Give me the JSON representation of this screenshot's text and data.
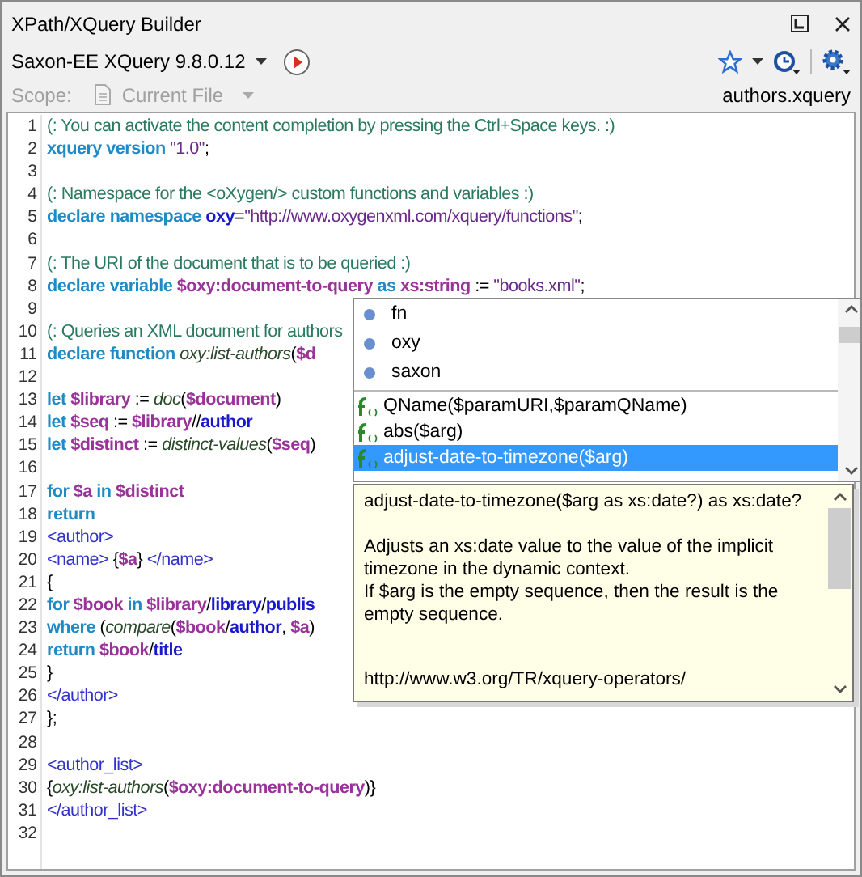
{
  "window": {
    "title": "XPath/XQuery Builder"
  },
  "toolbar": {
    "processor": "Saxon-EE XQuery 9.8.0.12"
  },
  "scope": {
    "label": "Scope:",
    "value": "Current File",
    "disabled": true,
    "file": "authors.xquery"
  },
  "editor": {
    "lines": [
      {
        "number": "1",
        "segments": [
          {
            "kind": "comment",
            "text": "(: You can activate the content completion by pressing the Ctrl+Space keys. :)"
          }
        ]
      },
      {
        "number": "2",
        "segments": [
          {
            "kind": "keyword",
            "text": "xquery version "
          },
          {
            "kind": "string",
            "text": "\"1.0\""
          },
          {
            "kind": "plain",
            "text": ";"
          }
        ]
      },
      {
        "number": "3"
      },
      {
        "number": "4",
        "segments": [
          {
            "kind": "comment",
            "text": "(: Namespace for the <oXygen/> custom functions and variables :)"
          }
        ]
      },
      {
        "number": "5",
        "segments": [
          {
            "kind": "keyword",
            "text": "declare namespace "
          },
          {
            "kind": "name",
            "text": "oxy"
          },
          {
            "kind": "plain",
            "text": "="
          },
          {
            "kind": "string",
            "text": "\"http://www.oxygenxml.com/xquery/functions\""
          },
          {
            "kind": "plain",
            "text": ";"
          }
        ]
      },
      {
        "number": "6"
      },
      {
        "number": "7",
        "segments": [
          {
            "kind": "comment",
            "text": "(: The URI of the document that is to be queried :)"
          }
        ]
      },
      {
        "number": "8",
        "segments": [
          {
            "kind": "keyword",
            "text": "declare variable "
          },
          {
            "kind": "variable",
            "text": "$oxy:document-to-query"
          },
          {
            "kind": "keyword",
            "text": " as "
          },
          {
            "kind": "variable",
            "text": "xs:string"
          },
          {
            "kind": "plain",
            "text": " := "
          },
          {
            "kind": "string",
            "text": "\"books.xml\""
          },
          {
            "kind": "plain",
            "text": ";"
          }
        ]
      },
      {
        "number": "9"
      },
      {
        "number": "10",
        "segments": [
          {
            "kind": "comment",
            "text": "(: Queries an XML document for authors"
          }
        ]
      },
      {
        "number": "11",
        "segments": [
          {
            "kind": "keyword",
            "text": "declare function "
          },
          {
            "kind": "func",
            "text": "oxy:list-authors"
          },
          {
            "kind": "plain",
            "text": "("
          },
          {
            "kind": "variable",
            "text": "$d"
          }
        ]
      },
      {
        "number": "12"
      },
      {
        "number": "13",
        "segments": [
          {
            "kind": "keyword",
            "text": "let "
          },
          {
            "kind": "variable",
            "text": "$library"
          },
          {
            "kind": "plain",
            "text": " := "
          },
          {
            "kind": "func",
            "text": "doc"
          },
          {
            "kind": "plain",
            "text": "("
          },
          {
            "kind": "variable",
            "text": "$document"
          },
          {
            "kind": "plain",
            "text": ")"
          }
        ]
      },
      {
        "number": "14",
        "segments": [
          {
            "kind": "keyword",
            "text": "let "
          },
          {
            "kind": "variable",
            "text": "$seq"
          },
          {
            "kind": "plain",
            "text": " := "
          },
          {
            "kind": "variable",
            "text": "$library"
          },
          {
            "kind": "plain",
            "text": "//"
          },
          {
            "kind": "name",
            "text": "author"
          }
        ]
      },
      {
        "number": "15",
        "segments": [
          {
            "kind": "keyword",
            "text": "let "
          },
          {
            "kind": "variable",
            "text": "$distinct"
          },
          {
            "kind": "plain",
            "text": " := "
          },
          {
            "kind": "func",
            "text": "distinct-values"
          },
          {
            "kind": "plain",
            "text": "("
          },
          {
            "kind": "variable",
            "text": "$seq"
          },
          {
            "kind": "plain",
            "text": ")"
          }
        ]
      },
      {
        "number": "16"
      },
      {
        "number": "17",
        "segments": [
          {
            "kind": "keyword",
            "text": "for "
          },
          {
            "kind": "variable",
            "text": "$a"
          },
          {
            "kind": "keyword",
            "text": " in "
          },
          {
            "kind": "variable",
            "text": "$distinct"
          }
        ]
      },
      {
        "number": "18",
        "segments": [
          {
            "kind": "keyword",
            "text": "return"
          }
        ]
      },
      {
        "number": "19",
        "segments": [
          {
            "kind": "tag",
            "text": "<author>"
          }
        ]
      },
      {
        "number": "20",
        "segments": [
          {
            "kind": "tag",
            "text": "<name> "
          },
          {
            "kind": "plain",
            "text": "{"
          },
          {
            "kind": "variable",
            "text": "$a"
          },
          {
            "kind": "plain",
            "text": "} "
          },
          {
            "kind": "tag",
            "text": "</name>"
          }
        ]
      },
      {
        "number": "21",
        "segments": [
          {
            "kind": "plain",
            "text": "{"
          }
        ]
      },
      {
        "number": "22",
        "segments": [
          {
            "kind": "keyword",
            "text": "for "
          },
          {
            "kind": "variable",
            "text": "$book"
          },
          {
            "kind": "keyword",
            "text": " in "
          },
          {
            "kind": "variable",
            "text": "$library"
          },
          {
            "kind": "plain",
            "text": "/"
          },
          {
            "kind": "name",
            "text": "library"
          },
          {
            "kind": "plain",
            "text": "/"
          },
          {
            "kind": "name",
            "text": "publis"
          }
        ]
      },
      {
        "number": "23",
        "segments": [
          {
            "kind": "keyword",
            "text": "where "
          },
          {
            "kind": "plain",
            "text": "("
          },
          {
            "kind": "func",
            "text": "compare"
          },
          {
            "kind": "plain",
            "text": "("
          },
          {
            "kind": "variable",
            "text": "$book"
          },
          {
            "kind": "plain",
            "text": "/"
          },
          {
            "kind": "name",
            "text": "author"
          },
          {
            "kind": "plain",
            "text": ", "
          },
          {
            "kind": "variable",
            "text": "$a"
          },
          {
            "kind": "plain",
            "text": ")"
          }
        ]
      },
      {
        "number": "24",
        "segments": [
          {
            "kind": "keyword",
            "text": "return "
          },
          {
            "kind": "variable",
            "text": "$book"
          },
          {
            "kind": "plain",
            "text": "/"
          },
          {
            "kind": "name",
            "text": "title"
          }
        ]
      },
      {
        "number": "25",
        "segments": [
          {
            "kind": "plain",
            "text": "}"
          }
        ]
      },
      {
        "number": "26",
        "segments": [
          {
            "kind": "tag",
            "text": "</author>"
          }
        ]
      },
      {
        "number": "27",
        "segments": [
          {
            "kind": "plain",
            "text": "};"
          }
        ]
      },
      {
        "number": "28"
      },
      {
        "number": "29",
        "segments": [
          {
            "kind": "tag",
            "text": "<author_list>"
          }
        ]
      },
      {
        "number": "30",
        "segments": [
          {
            "kind": "plain",
            "text": "{"
          },
          {
            "kind": "func",
            "text": "oxy:list-authors"
          },
          {
            "kind": "plain",
            "text": "("
          },
          {
            "kind": "variable",
            "text": "$oxy:document-to-query"
          },
          {
            "kind": "plain",
            "text": ")}"
          }
        ]
      },
      {
        "number": "31",
        "segments": [
          {
            "kind": "tag",
            "text": "</author_list>"
          }
        ]
      },
      {
        "number": "32"
      }
    ]
  },
  "completion": {
    "namespaces": [
      {
        "text": "fn",
        "selected": false
      },
      {
        "text": "oxy",
        "selected": false
      },
      {
        "text": "saxon",
        "selected": false
      }
    ],
    "functions": [
      {
        "text": "QName($paramURI,$paramQName)",
        "selected": false
      },
      {
        "text": "abs($arg)",
        "selected": false
      },
      {
        "text": "adjust-date-to-timezone($arg)",
        "selected": true
      }
    ]
  },
  "documentation": {
    "signature": "adjust-date-to-timezone($arg as xs:date?) as xs:date?",
    "paragraphs": [
      "Adjusts an xs:date value to the value of the implicit timezone in the dynamic context.",
      "If $arg is the empty sequence, then the result is the empty sequence."
    ],
    "url": "http://www.w3.org/TR/xquery-operators/"
  }
}
